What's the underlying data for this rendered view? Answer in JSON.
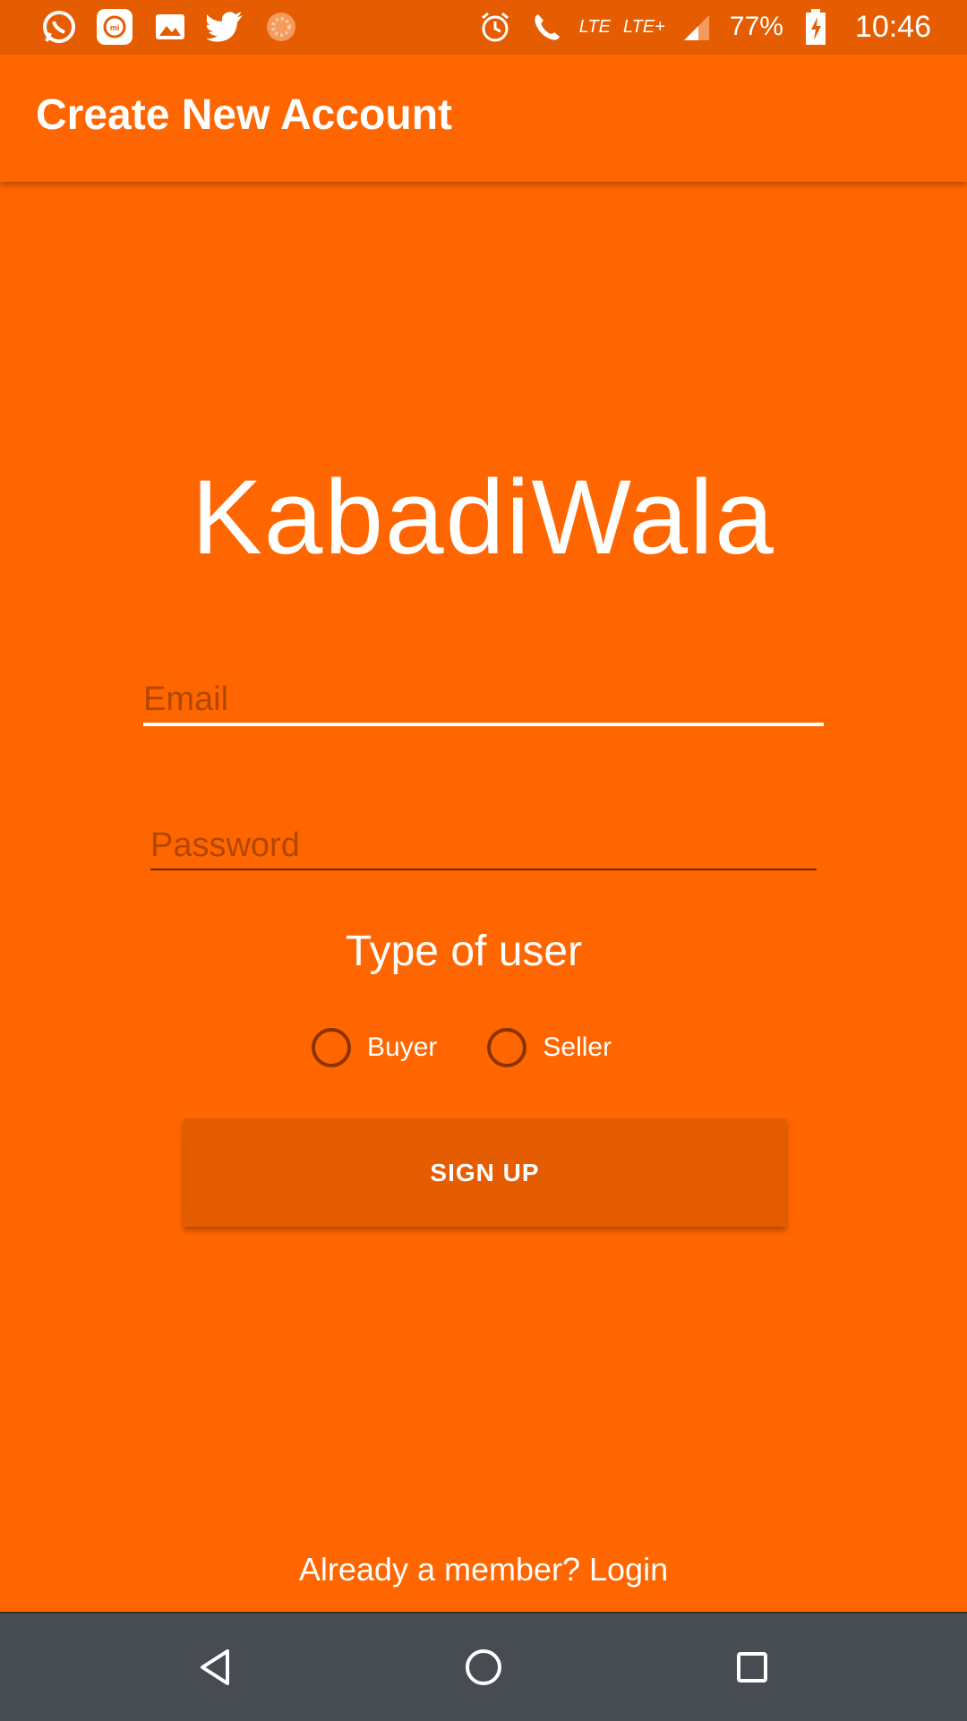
{
  "status_bar": {
    "left_icons": [
      "whatsapp-icon",
      "mi-icon",
      "gallery-icon",
      "twitter-icon",
      "loading-icon"
    ],
    "network1": "LTE",
    "network2": "LTE+",
    "battery": "77%",
    "time": "10:46"
  },
  "app_bar": {
    "title": "Create New Account"
  },
  "brand": {
    "name": "KabadiWala"
  },
  "form": {
    "email": {
      "placeholder": "Email",
      "value": ""
    },
    "password": {
      "placeholder": "Password",
      "value": ""
    },
    "user_type_label": "Type of user",
    "options": [
      {
        "label": "Buyer",
        "checked": false
      },
      {
        "label": "Seller",
        "checked": false
      }
    ],
    "signup_label": "SIGN UP"
  },
  "footer": {
    "login_text": "Already a member? Login"
  },
  "colors": {
    "background": "#FF6600",
    "status_bar": "#E65C00",
    "nav_bar": "#474C52"
  }
}
